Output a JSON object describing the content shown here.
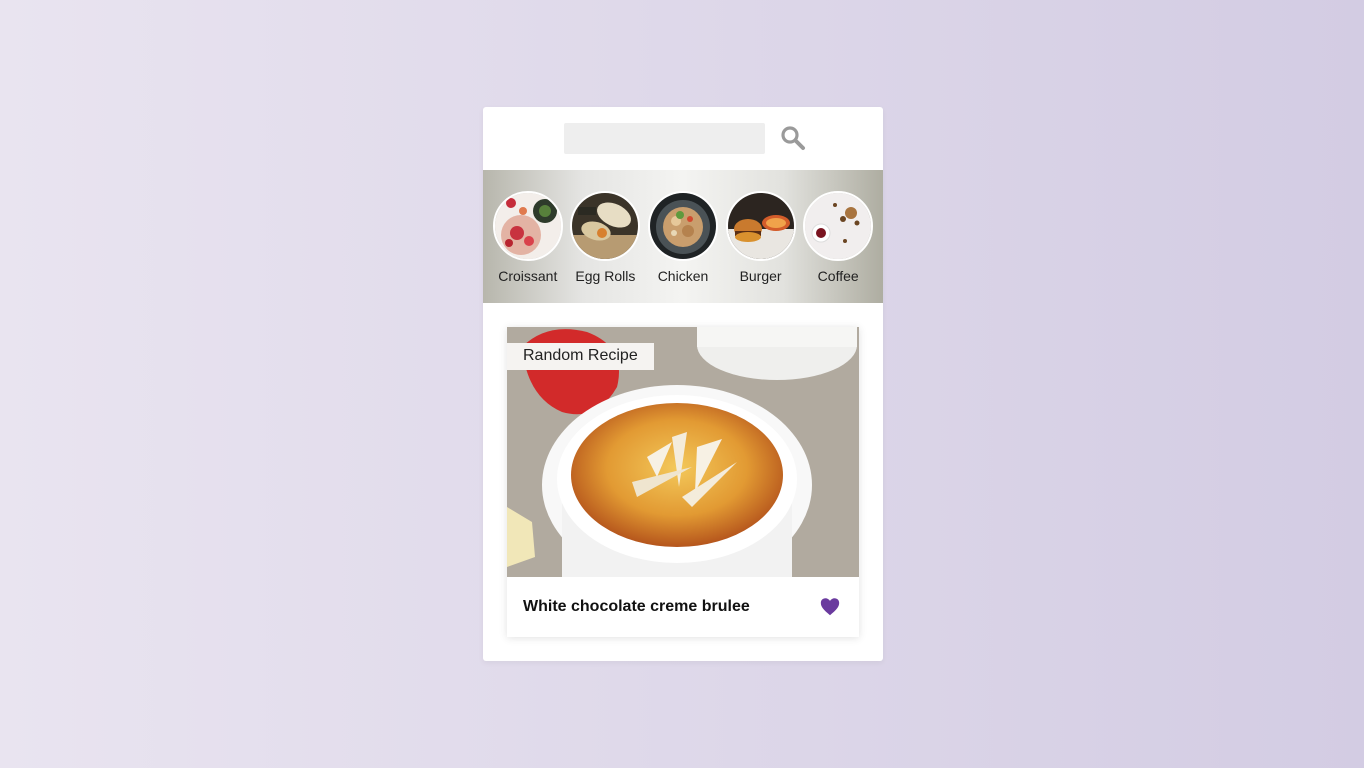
{
  "search": {
    "value": "",
    "placeholder": "",
    "icon": "search-icon",
    "icon_color": "#9a9a9a"
  },
  "categories": [
    {
      "label": "Croissant"
    },
    {
      "label": "Egg Rolls"
    },
    {
      "label": "Chicken"
    },
    {
      "label": "Burger"
    },
    {
      "label": "Coffee"
    }
  ],
  "card": {
    "tag": "Random Recipe",
    "title": "White chocolate creme brulee",
    "favorite_icon": "heart-icon",
    "favorite_color": "#6a3a9e"
  }
}
